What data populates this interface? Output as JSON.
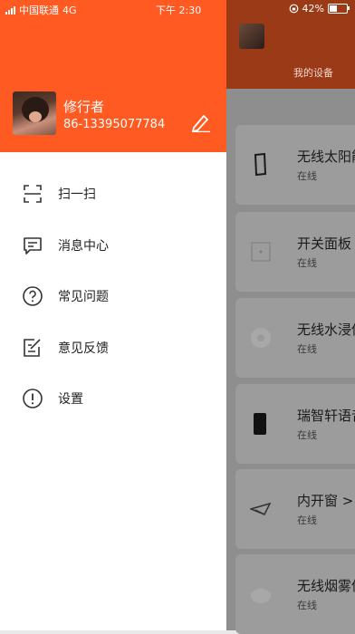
{
  "status_bar": {
    "carrier": "中国联通",
    "network": "4G",
    "time": "下午 2:30",
    "battery_percent": "42%",
    "battery_level": 0.42
  },
  "user": {
    "name": "修行者",
    "phone": "86-13395077784"
  },
  "menu": [
    {
      "label": "扫一扫",
      "icon": "scan-icon"
    },
    {
      "label": "消息中心",
      "icon": "message-icon"
    },
    {
      "label": "常见问题",
      "icon": "question-icon"
    },
    {
      "label": "意见反馈",
      "icon": "feedback-icon"
    },
    {
      "label": "设置",
      "icon": "settings-icon"
    }
  ],
  "background": {
    "tab_label": "我的设备",
    "devices": [
      {
        "name": "无线太阳能",
        "status": "在线"
      },
      {
        "name": "开关面板",
        "status": "在线"
      },
      {
        "name": "无线水浸传",
        "status": "在线"
      },
      {
        "name": "瑞智轩语音",
        "status": "在线"
      },
      {
        "name": "内开窗 >",
        "status": "在线"
      },
      {
        "name": "无线烟雾传",
        "status": "在线"
      }
    ]
  },
  "colors": {
    "accent": "#ff5a22",
    "overlay": "#8e8e8e"
  }
}
